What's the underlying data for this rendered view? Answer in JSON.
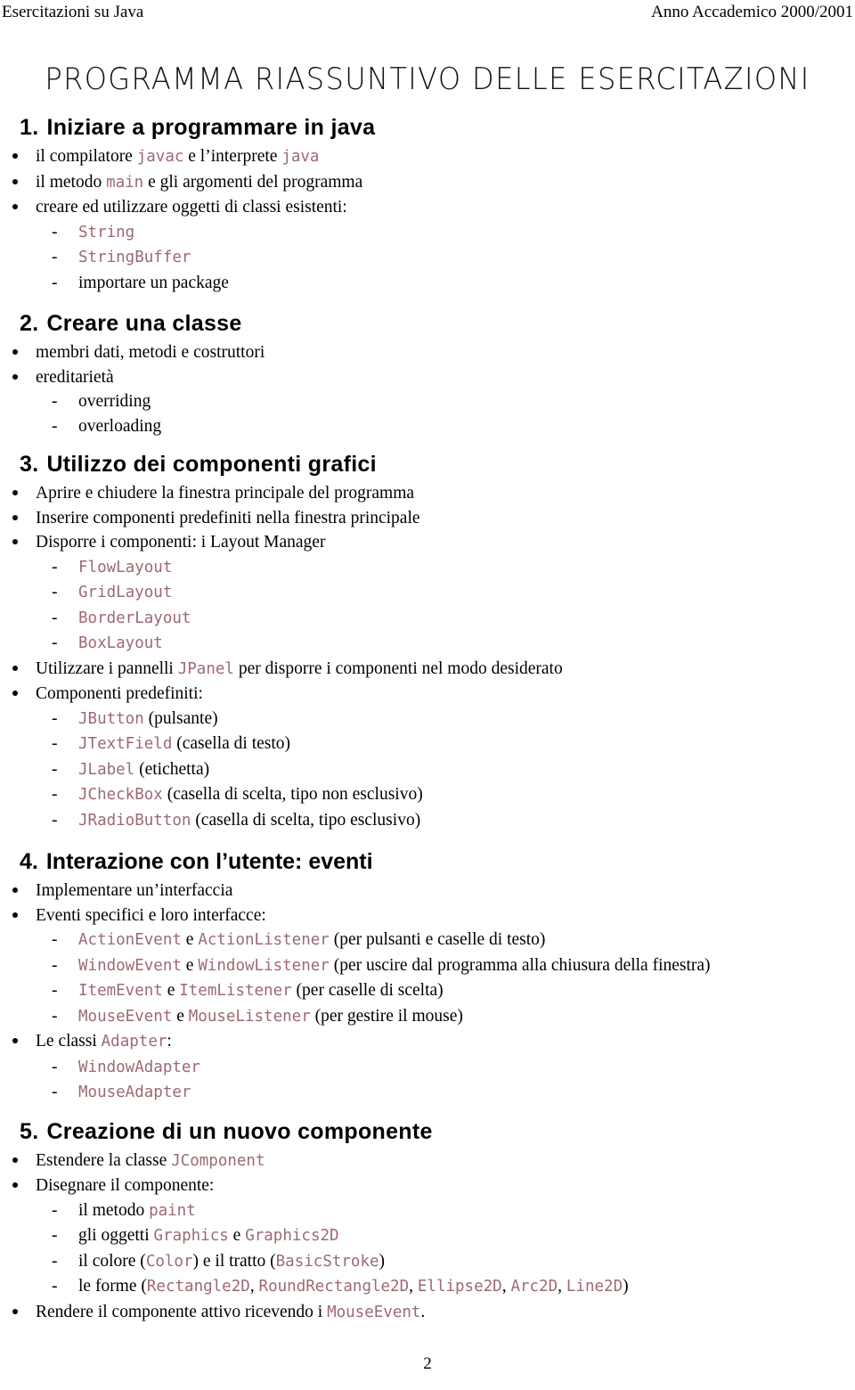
{
  "header": {
    "left": "Esercitazioni su Java",
    "right": "Anno Accademico 2000/2001"
  },
  "title": "PROGRAMMA RIASSUNTIVO DELLE ESERCITAZIONI",
  "page_number": "2",
  "colors": {
    "code": "#9c6a71",
    "text": "#000000",
    "background": "#ffffff"
  },
  "sections": [
    {
      "num": "1.",
      "heading": "Iniziare a programmare in java",
      "items": [
        {
          "level": "bullet",
          "parts": [
            {
              "t": "text",
              "v": "il compilatore "
            },
            {
              "t": "code",
              "v": "javac"
            },
            {
              "t": "text",
              "v": " e l’interprete "
            },
            {
              "t": "code",
              "v": "java"
            }
          ]
        },
        {
          "level": "bullet",
          "parts": [
            {
              "t": "text",
              "v": "il metodo "
            },
            {
              "t": "code",
              "v": "main"
            },
            {
              "t": "text",
              "v": " e gli argomenti del programma"
            }
          ]
        },
        {
          "level": "bullet",
          "parts": [
            {
              "t": "text",
              "v": "creare ed utilizzare oggetti di classi esistenti:"
            }
          ]
        },
        {
          "level": "sub",
          "parts": [
            {
              "t": "code",
              "v": "String"
            }
          ]
        },
        {
          "level": "sub",
          "parts": [
            {
              "t": "code",
              "v": "StringBuffer"
            }
          ]
        },
        {
          "level": "sub",
          "parts": [
            {
              "t": "text",
              "v": "importare un package"
            }
          ]
        }
      ]
    },
    {
      "num": "2.",
      "heading": "Creare una classe",
      "items": [
        {
          "level": "bullet",
          "parts": [
            {
              "t": "text",
              "v": "membri dati, metodi e costruttori"
            }
          ]
        },
        {
          "level": "bullet",
          "parts": [
            {
              "t": "text",
              "v": "ereditarietà"
            }
          ]
        },
        {
          "level": "sub",
          "parts": [
            {
              "t": "text",
              "v": "overriding"
            }
          ]
        },
        {
          "level": "sub",
          "parts": [
            {
              "t": "text",
              "v": "overloading"
            }
          ]
        }
      ]
    },
    {
      "num": "3.",
      "heading": "Utilizzo dei componenti grafici",
      "items": [
        {
          "level": "bullet",
          "parts": [
            {
              "t": "text",
              "v": "Aprire e chiudere la finestra principale del programma"
            }
          ]
        },
        {
          "level": "bullet",
          "parts": [
            {
              "t": "text",
              "v": "Inserire componenti predefiniti nella finestra principale"
            }
          ]
        },
        {
          "level": "bullet",
          "parts": [
            {
              "t": "text",
              "v": "Disporre i componenti: i Layout Manager"
            }
          ]
        },
        {
          "level": "sub",
          "parts": [
            {
              "t": "code",
              "v": "FlowLayout"
            }
          ]
        },
        {
          "level": "sub",
          "parts": [
            {
              "t": "code",
              "v": "GridLayout"
            }
          ]
        },
        {
          "level": "sub",
          "parts": [
            {
              "t": "code",
              "v": "BorderLayout"
            }
          ]
        },
        {
          "level": "sub",
          "parts": [
            {
              "t": "code",
              "v": "BoxLayout"
            }
          ]
        },
        {
          "level": "bullet",
          "parts": [
            {
              "t": "text",
              "v": "Utilizzare i pannelli "
            },
            {
              "t": "code",
              "v": "JPanel"
            },
            {
              "t": "text",
              "v": " per disporre i componenti nel modo desiderato"
            }
          ]
        },
        {
          "level": "bullet",
          "parts": [
            {
              "t": "text",
              "v": "Componenti predefiniti:"
            }
          ]
        },
        {
          "level": "sub",
          "parts": [
            {
              "t": "code",
              "v": "JButton"
            },
            {
              "t": "text",
              "v": " (pulsante)"
            }
          ]
        },
        {
          "level": "sub",
          "parts": [
            {
              "t": "code",
              "v": "JTextField"
            },
            {
              "t": "text",
              "v": " (casella di testo)"
            }
          ]
        },
        {
          "level": "sub",
          "parts": [
            {
              "t": "code",
              "v": "JLabel"
            },
            {
              "t": "text",
              "v": " (etichetta)"
            }
          ]
        },
        {
          "level": "sub",
          "parts": [
            {
              "t": "code",
              "v": "JCheckBox"
            },
            {
              "t": "text",
              "v": " (casella di scelta, tipo non esclusivo)"
            }
          ]
        },
        {
          "level": "sub",
          "parts": [
            {
              "t": "code",
              "v": "JRadioButton"
            },
            {
              "t": "text",
              "v": " (casella di scelta, tipo esclusivo)"
            }
          ]
        }
      ]
    },
    {
      "num": "4.",
      "heading": "Interazione con l’utente: eventi",
      "items": [
        {
          "level": "bullet",
          "parts": [
            {
              "t": "text",
              "v": "Implementare un’interfaccia"
            }
          ]
        },
        {
          "level": "bullet",
          "parts": [
            {
              "t": "text",
              "v": "Eventi specifici e loro interfacce:"
            }
          ]
        },
        {
          "level": "sub",
          "parts": [
            {
              "t": "code",
              "v": "ActionEvent"
            },
            {
              "t": "text",
              "v": " e "
            },
            {
              "t": "code",
              "v": "ActionListener"
            },
            {
              "t": "text",
              "v": " (per pulsanti e caselle di testo)"
            }
          ]
        },
        {
          "level": "sub",
          "parts": [
            {
              "t": "code",
              "v": "WindowEvent"
            },
            {
              "t": "text",
              "v": " e "
            },
            {
              "t": "code",
              "v": "WindowListener"
            },
            {
              "t": "text",
              "v": " (per uscire dal programma alla chiusura della finestra)"
            }
          ]
        },
        {
          "level": "sub",
          "parts": [
            {
              "t": "code",
              "v": "ItemEvent"
            },
            {
              "t": "text",
              "v": " e "
            },
            {
              "t": "code",
              "v": "ItemListener"
            },
            {
              "t": "text",
              "v": " (per caselle di scelta)"
            }
          ]
        },
        {
          "level": "sub",
          "parts": [
            {
              "t": "code",
              "v": "MouseEvent"
            },
            {
              "t": "text",
              "v": " e "
            },
            {
              "t": "code",
              "v": "MouseListener"
            },
            {
              "t": "text",
              "v": " (per gestire il mouse)"
            }
          ]
        },
        {
          "level": "bullet",
          "parts": [
            {
              "t": "text",
              "v": "Le classi "
            },
            {
              "t": "code",
              "v": "Adapter"
            },
            {
              "t": "text",
              "v": ":"
            }
          ]
        },
        {
          "level": "sub",
          "parts": [
            {
              "t": "code",
              "v": "WindowAdapter"
            }
          ]
        },
        {
          "level": "sub",
          "parts": [
            {
              "t": "code",
              "v": "MouseAdapter"
            }
          ]
        }
      ]
    },
    {
      "num": "5.",
      "heading": "Creazione di un nuovo componente",
      "items": [
        {
          "level": "bullet",
          "parts": [
            {
              "t": "text",
              "v": "Estendere la classe "
            },
            {
              "t": "code",
              "v": "JComponent"
            }
          ]
        },
        {
          "level": "bullet",
          "parts": [
            {
              "t": "text",
              "v": "Disegnare il componente:"
            }
          ]
        },
        {
          "level": "sub",
          "parts": [
            {
              "t": "text",
              "v": "il metodo "
            },
            {
              "t": "code",
              "v": "paint"
            }
          ]
        },
        {
          "level": "sub",
          "parts": [
            {
              "t": "text",
              "v": "gli oggetti "
            },
            {
              "t": "code",
              "v": "Graphics"
            },
            {
              "t": "text",
              "v": " e "
            },
            {
              "t": "code",
              "v": "Graphics2D"
            }
          ]
        },
        {
          "level": "sub",
          "parts": [
            {
              "t": "text",
              "v": "il colore ("
            },
            {
              "t": "code",
              "v": "Color"
            },
            {
              "t": "text",
              "v": ") e il tratto ("
            },
            {
              "t": "code",
              "v": "BasicStroke"
            },
            {
              "t": "text",
              "v": ")"
            }
          ]
        },
        {
          "level": "sub",
          "parts": [
            {
              "t": "text",
              "v": "le forme ("
            },
            {
              "t": "code",
              "v": "Rectangle2D"
            },
            {
              "t": "text",
              "v": ", "
            },
            {
              "t": "code",
              "v": "RoundRectangle2D"
            },
            {
              "t": "text",
              "v": ", "
            },
            {
              "t": "code",
              "v": "Ellipse2D"
            },
            {
              "t": "text",
              "v": ", "
            },
            {
              "t": "code",
              "v": "Arc2D"
            },
            {
              "t": "text",
              "v": ", "
            },
            {
              "t": "code",
              "v": "Line2D"
            },
            {
              "t": "text",
              "v": ")"
            }
          ]
        },
        {
          "level": "bullet",
          "parts": [
            {
              "t": "text",
              "v": "Rendere il componente attivo ricevendo i "
            },
            {
              "t": "code",
              "v": "MouseEvent"
            },
            {
              "t": "text",
              "v": "."
            }
          ]
        }
      ]
    }
  ]
}
